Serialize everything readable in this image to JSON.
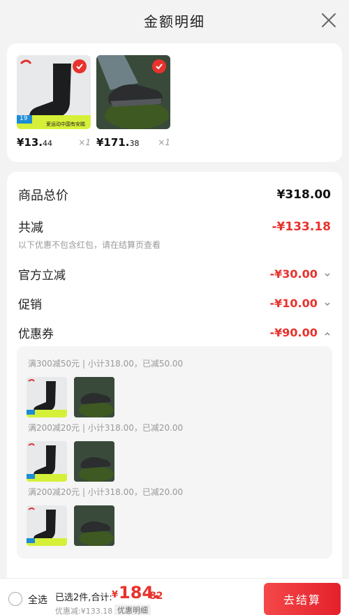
{
  "header": {
    "title": "金额明细"
  },
  "products": [
    {
      "price_int": "¥13.",
      "price_dec": "44",
      "qty": "×1",
      "badge": "19",
      "slogan": "爱运动中国有安踏"
    },
    {
      "price_int": "¥171.",
      "price_dec": "38",
      "qty": "×1"
    }
  ],
  "summary": {
    "total_label": "商品总价",
    "total_value": "¥318.00",
    "discount_label": "共减",
    "discount_value": "-¥133.18",
    "discount_note": "以下优惠不包含红包，请在结算页查看",
    "official_label": "官方立减",
    "official_value": "-¥30.00",
    "promo_label": "促销",
    "promo_value": "-¥10.00",
    "coupon_label": "优惠券",
    "coupon_value": "-¥90.00"
  },
  "coupons": [
    {
      "title": "满300减50元 | 小计318.00，已减50.00"
    },
    {
      "title": "满200减20元 | 小计318.00，已减20.00"
    },
    {
      "title": "满200减20元 | 小计318.00，已减20.00"
    }
  ],
  "bottom": {
    "select_all": "全选",
    "selected_summary": "已选2件,合计:",
    "total_sym": "¥",
    "total_int": "184.",
    "total_dec": "82",
    "discount_line": "优惠减:¥133.18",
    "detail_label": "优惠明细",
    "checkout_label": "去结算"
  },
  "colors": {
    "accent": "#e8322e",
    "background": "#f3f3f3"
  }
}
